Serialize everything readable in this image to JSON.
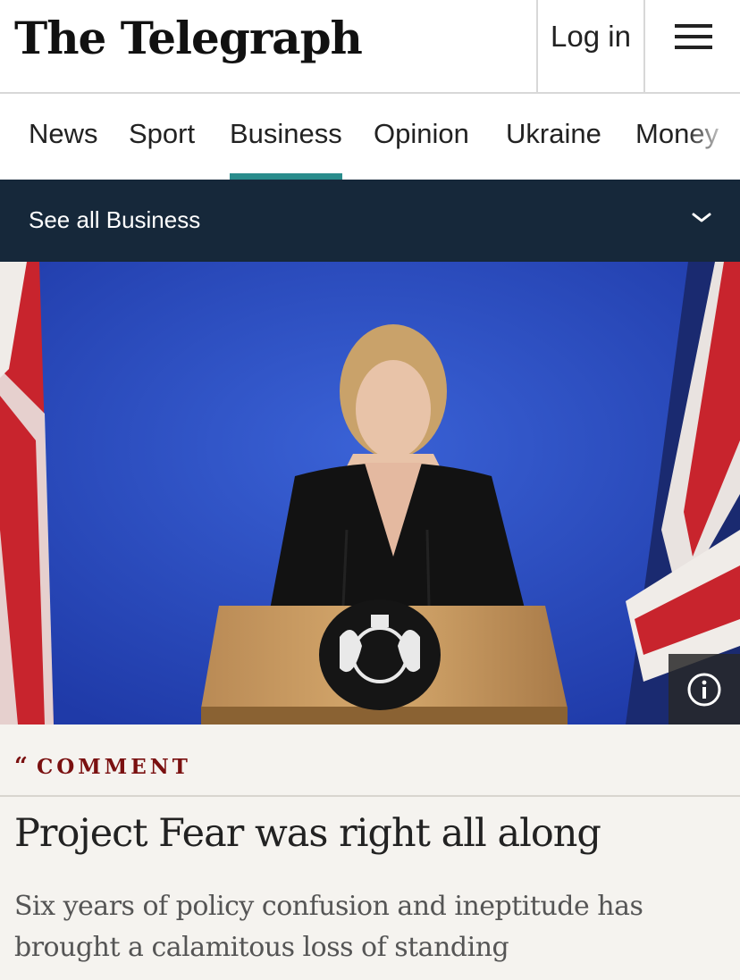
{
  "header": {
    "logo_text": "The Telegraph",
    "login_label": "Log in"
  },
  "nav": {
    "items": [
      {
        "label": "News"
      },
      {
        "label": "Sport"
      },
      {
        "label": "Business"
      },
      {
        "label": "Opinion"
      },
      {
        "label": "Ukraine"
      },
      {
        "label": "Money"
      }
    ],
    "active": "Business"
  },
  "section_bar": {
    "label": "See all Business"
  },
  "article": {
    "kicker_quote": "“",
    "kicker": "COMMENT",
    "headline": "Project Fear was right all along",
    "standfirst": "Six years of policy confusion and ineptitude has brought a calamitous loss of standing"
  },
  "colors": {
    "accent_teal": "#2a8c8c",
    "section_bar_bg": "#16283a",
    "kicker_red": "#7a1010",
    "page_bg": "#f5f3ef"
  }
}
